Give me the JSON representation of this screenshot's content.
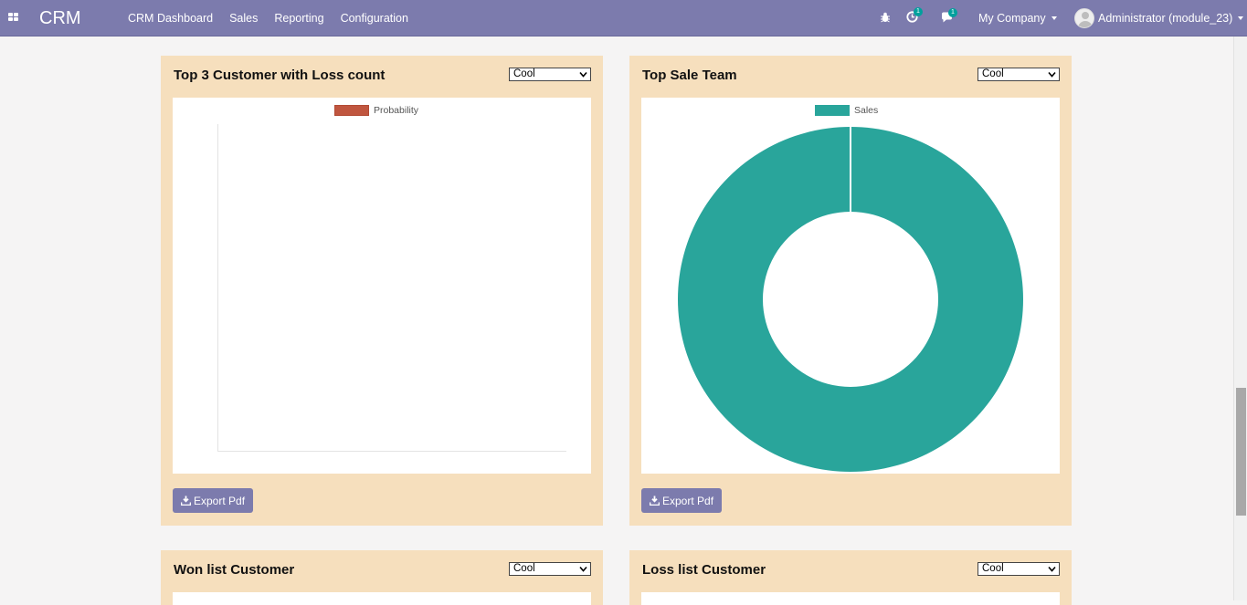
{
  "navbar": {
    "brand": "CRM",
    "menu": [
      "CRM Dashboard",
      "Sales",
      "Reporting",
      "Configuration"
    ],
    "activity_badge": "1",
    "messages_badge": "1",
    "company": "My Company",
    "user": "Administrator (module_23)"
  },
  "icons": {
    "apps": "apps-grid-icon",
    "debug": "bug-icon",
    "activity": "clock-icon",
    "messages": "chat-icon",
    "export": "download-icon"
  },
  "colors": {
    "navbar": "#7c7bad",
    "card_bg": "#f6dfbd",
    "probability": "#c0563f",
    "sales": "#29a59b",
    "button": "#7c7bad"
  },
  "cards": {
    "loss_count": {
      "title": "Top 3 Customer with Loss count",
      "theme": "Cool",
      "export_label": "Export Pdf"
    },
    "sale_team": {
      "title": "Top Sale Team",
      "theme": "Cool",
      "export_label": "Export Pdf"
    },
    "won_list": {
      "title": "Won list Customer",
      "theme": "Cool"
    },
    "loss_list": {
      "title": "Loss list Customer",
      "theme": "Cool"
    }
  },
  "chart_data": [
    {
      "type": "bar",
      "series": [
        {
          "name": "Probability",
          "values": []
        }
      ],
      "categories": []
    },
    {
      "type": "pie",
      "labels": [
        "Sales"
      ],
      "values": [
        1
      ],
      "series": [
        {
          "name": "Sales",
          "values": [
            1
          ]
        }
      ]
    }
  ]
}
